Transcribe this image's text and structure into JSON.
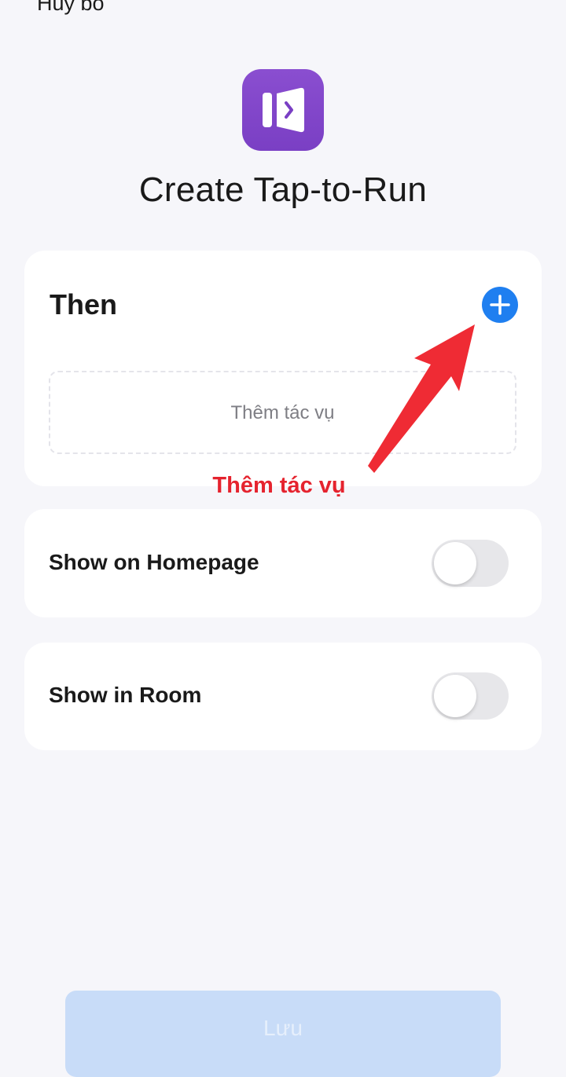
{
  "header": {
    "cancel_label": "Hủy bỏ",
    "title": "Create Tap-to-Run",
    "app_icon": "tap-to-run-icon"
  },
  "then_section": {
    "label": "Then",
    "add_icon": "plus-icon",
    "add_task_placeholder": "Thêm tác vụ"
  },
  "annotation": {
    "text": "Thêm tác vụ",
    "color": "#e5232e"
  },
  "settings": [
    {
      "label": "Show on Homepage",
      "enabled": false
    },
    {
      "label": "Show in Room",
      "enabled": false
    }
  ],
  "footer": {
    "save_label": "Lưu"
  },
  "colors": {
    "accent": "#1f7ff0",
    "app_icon": "#7a3fc4",
    "background": "#f6f6fa",
    "save_button_disabled": "#c8dcf8"
  }
}
